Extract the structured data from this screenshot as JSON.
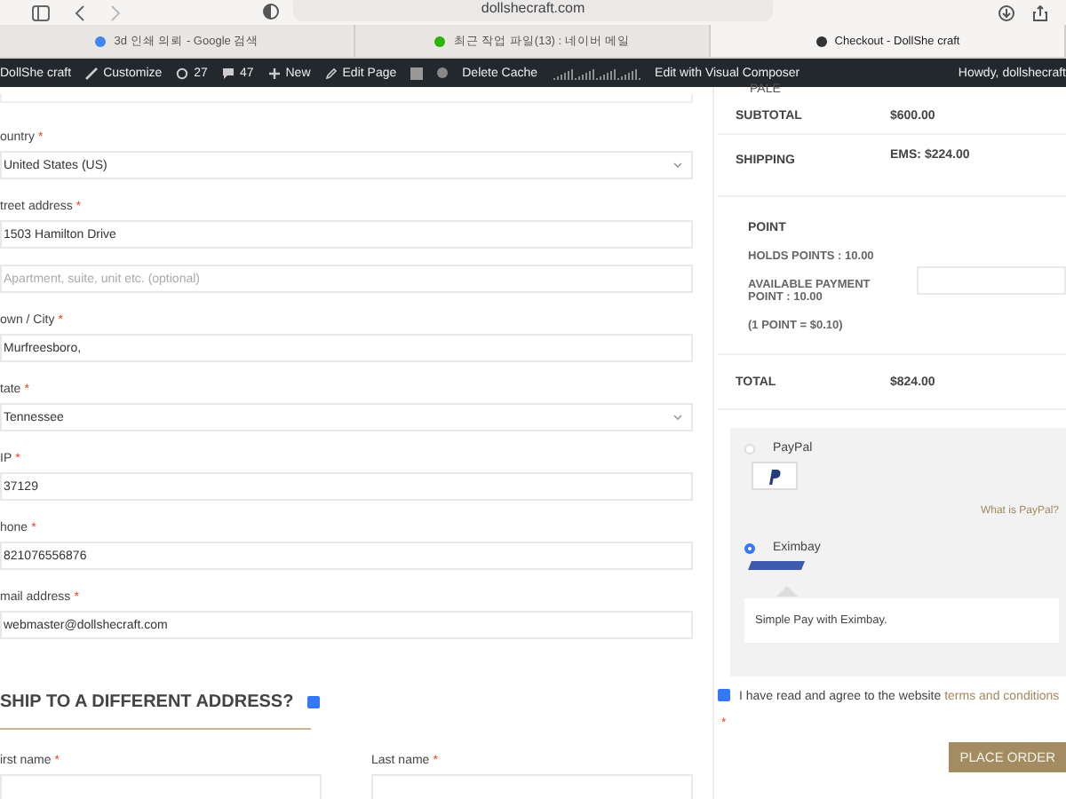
{
  "browser": {
    "address": "dollshecraft.com",
    "tabs": [
      {
        "title": "3d 인쇄 의뢰 - Google 검색",
        "selected": false
      },
      {
        "title": "최근 작업 파일(13) : 네이버 메일",
        "selected": false
      },
      {
        "title": "Checkout - DollShe craft",
        "selected": true
      }
    ]
  },
  "admin_bar": {
    "site": "DollShe craft",
    "customize": "Customize",
    "updates": "27",
    "comments": "47",
    "new": "New",
    "edit_page": "Edit Page",
    "delete_cache": "Delete Cache",
    "visual_composer": "Edit with Visual Composer",
    "greeting": "Howdy, dollshecraft"
  },
  "billing_fields": [
    {
      "kind": "select",
      "label": "ountry",
      "required_mark": "*",
      "value": "United States (US)"
    },
    {
      "kind": "text",
      "label": "treet address",
      "required_mark": "*",
      "value": "1503 Hamilton Drive"
    },
    {
      "kind": "text",
      "placeholder": "Apartment, suite, unit etc. (optional)"
    },
    {
      "kind": "text",
      "label": "own / City",
      "required_mark": "*",
      "value": "Murfreesboro,"
    },
    {
      "kind": "select",
      "label": "tate",
      "required_mark": "*",
      "value": "Tennessee"
    },
    {
      "kind": "text",
      "label": "IP",
      "required_mark": "*",
      "value": "37129"
    },
    {
      "kind": "text",
      "label": "hone",
      "required_mark": "*",
      "value": "821076556876"
    },
    {
      "kind": "text",
      "label": "mail address",
      "required_mark": "*",
      "value": "webmaster@dollshecraft.com"
    }
  ],
  "ship_different": {
    "heading": "SHIP TO A DIFFERENT ADDRESS?",
    "checked": true
  },
  "shipping_fields": [
    {
      "label": "irst name",
      "required_mark": "*"
    },
    {
      "label": "Last name",
      "required_mark": "*"
    }
  ],
  "order": {
    "product_fragment": "PALE",
    "subtotal_label": "SUBTOTAL",
    "subtotal": "$600.00",
    "shipping_label": "SHIPPING",
    "shipping": "EMS: $224.00",
    "point": {
      "title": "POINT",
      "holds": "HOLDS POINTS : 10.00",
      "available": "AVAILABLE PAYMENT POINT : 10.00",
      "rate": "(1 POINT = $0.10)"
    },
    "total_label": "TOTAL",
    "total": "$824.00"
  },
  "payment_methods": [
    {
      "name": "PayPal",
      "selected": false,
      "link": "What is PayPal?"
    },
    {
      "name": "Eximbay",
      "selected": true,
      "description": "Simple Pay with Eximbay."
    }
  ],
  "terms": {
    "checked": true,
    "text": "I have read and agree to the website",
    "link": "terms and conditions",
    "required_mark": "*"
  },
  "place_order": "PLACE ORDER"
}
